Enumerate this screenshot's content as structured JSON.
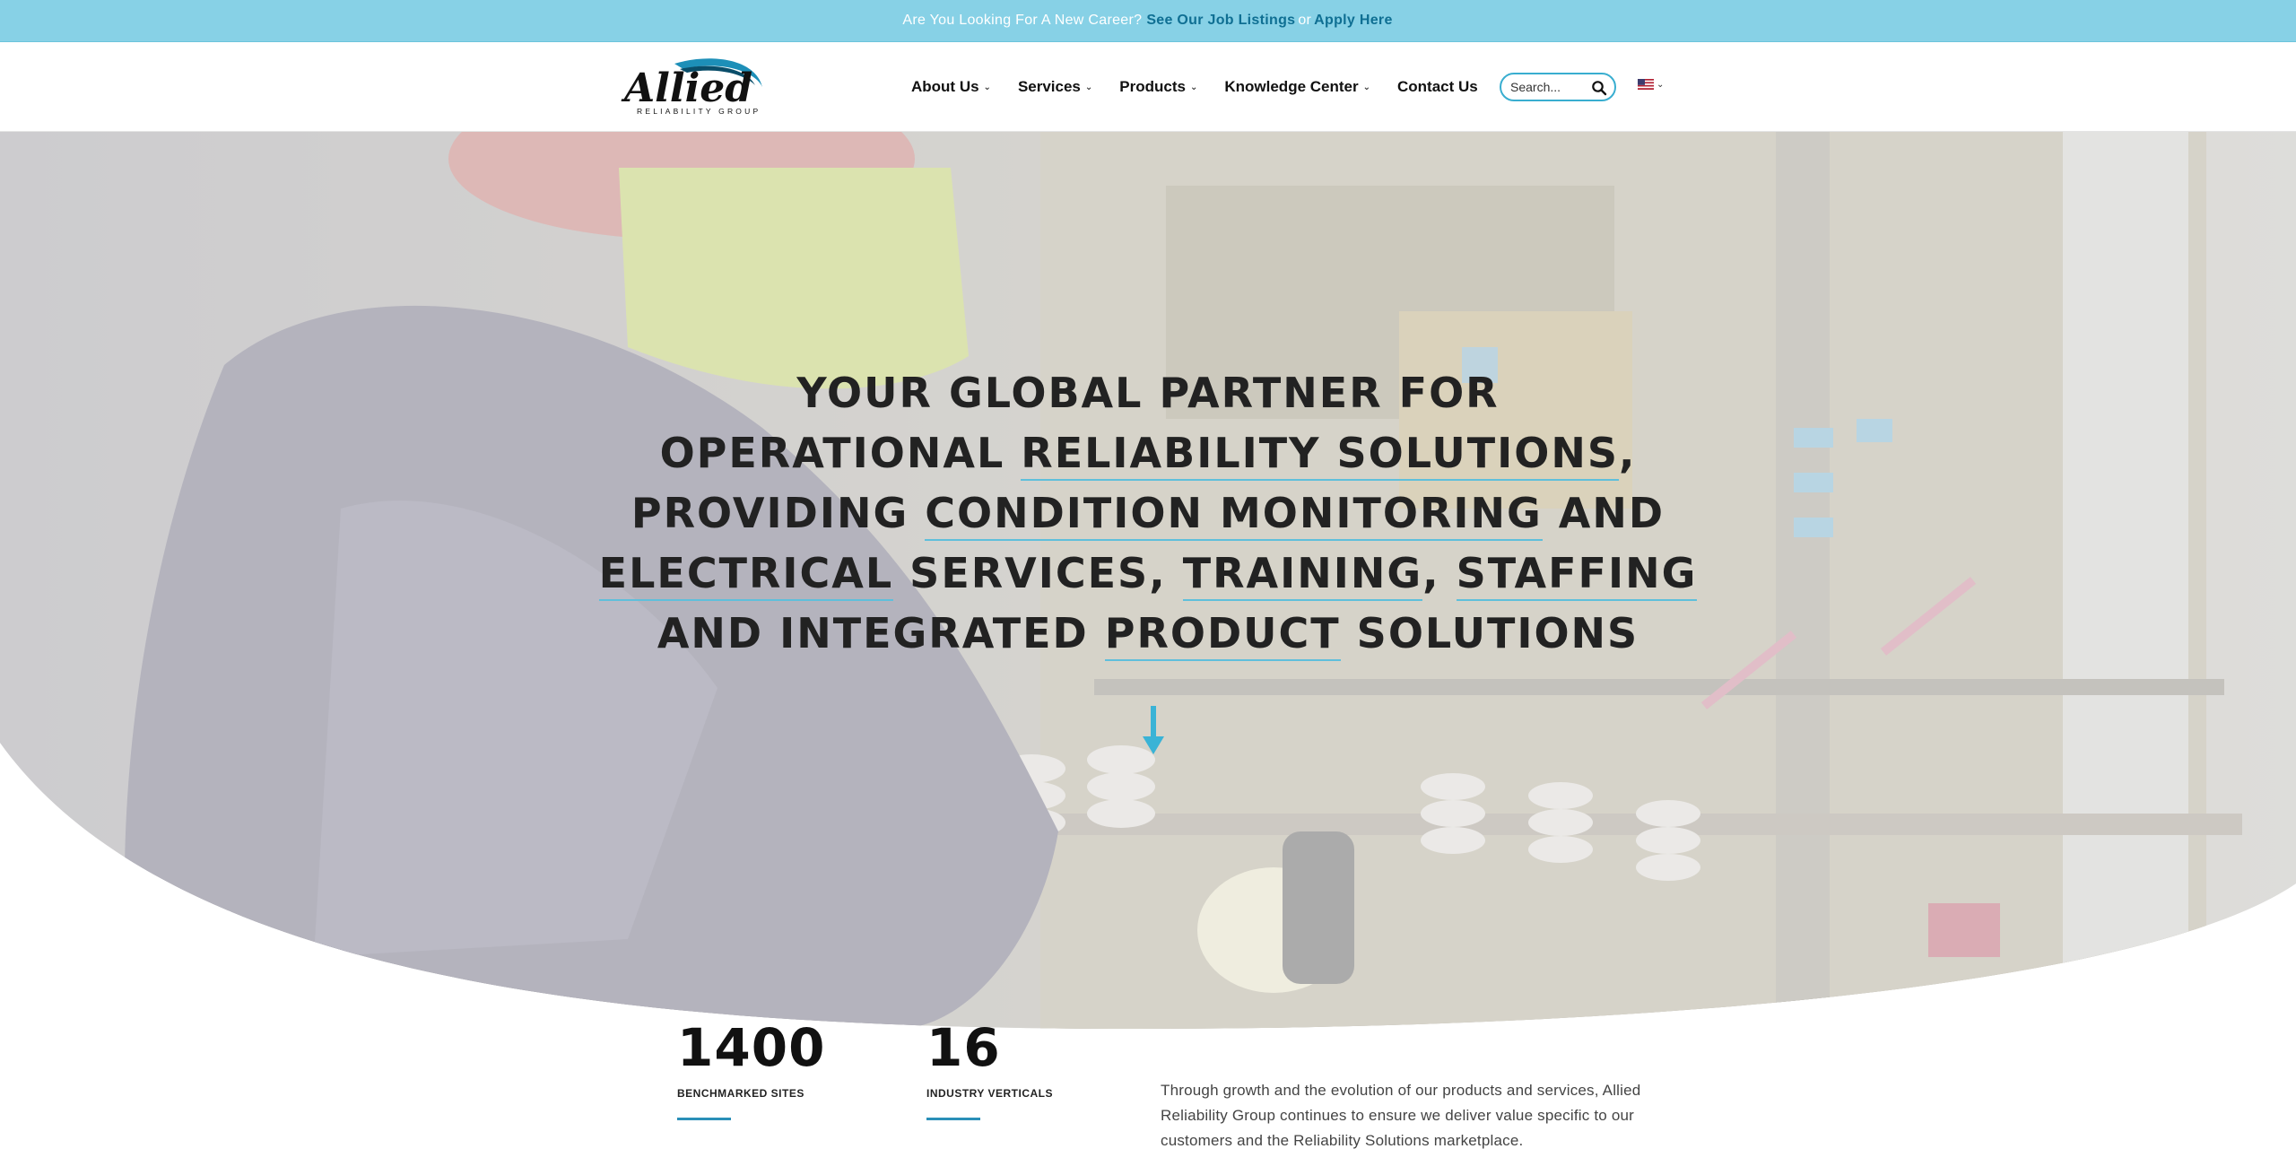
{
  "topbar": {
    "prefix": "Are You Looking For A New Career?",
    "job_link": "See Our Job Listings",
    "or": "or",
    "apply_link": "Apply Here"
  },
  "header": {
    "logo_text": "Allied",
    "logo_subtext": "RELIABILITY GROUP",
    "nav": [
      {
        "label": "About Us",
        "has_dropdown": true
      },
      {
        "label": "Services",
        "has_dropdown": true
      },
      {
        "label": "Products",
        "has_dropdown": true
      },
      {
        "label": "Knowledge Center",
        "has_dropdown": true
      },
      {
        "label": "Contact Us",
        "has_dropdown": false
      }
    ],
    "search_placeholder": "Search...",
    "language_icon": "us-flag-icon"
  },
  "hero": {
    "lines": [
      [
        "YOUR GLOBAL PARTNER FOR"
      ],
      [
        "OPERATIONAL ",
        "RELIABILITY SOLUTIONS",
        ","
      ],
      [
        "PROVIDING ",
        "CONDITION MONITORING",
        " AND"
      ],
      [
        "ELECTRICAL",
        " SERVICES, ",
        "TRAINING",
        ", ",
        "STAFFING"
      ],
      [
        "AND INTEGRATED ",
        "PRODUCT",
        " SOLUTIONS"
      ]
    ]
  },
  "stats": [
    {
      "value": "1400",
      "label": "BENCHMARKED SITES"
    },
    {
      "value": "16",
      "label": "INDUSTRY VERTICALS"
    }
  ],
  "intro_text": "Through growth and the evolution of our products and services, Allied Reliability Group continues to ensure we deliver value specific to our customers and the Reliability Solutions marketplace.",
  "colors": {
    "topbar_bg": "#87d1e6",
    "accent": "#39aed0",
    "link": "#0f6f93"
  }
}
